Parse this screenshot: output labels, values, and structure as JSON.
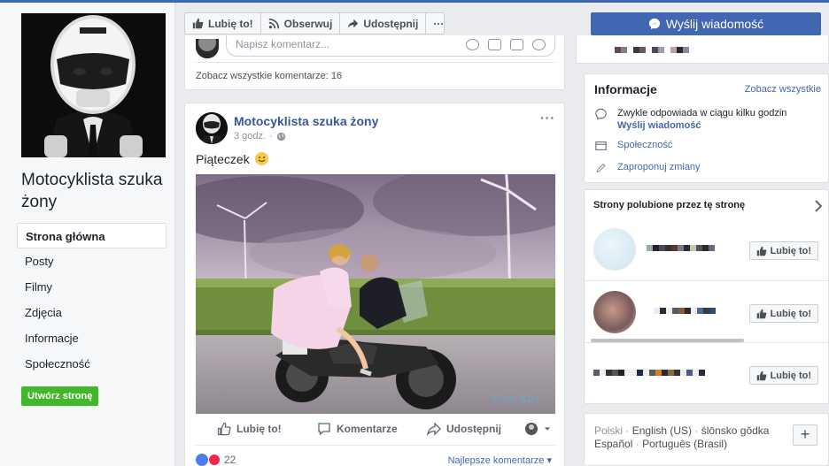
{
  "page": {
    "name": "Motocyklista szuka żony"
  },
  "nav": {
    "items": [
      {
        "label": "Strona główna",
        "active": true
      },
      {
        "label": "Posty"
      },
      {
        "label": "Filmy"
      },
      {
        "label": "Zdjęcia"
      },
      {
        "label": "Informacje"
      },
      {
        "label": "Społeczność"
      }
    ],
    "create_page": "Utwórz stronę"
  },
  "action_bar": {
    "like": "Lubię to!",
    "follow": "Obserwuj",
    "share": "Udostępnij",
    "more": "···"
  },
  "send_message": "Wyślij wiadomość",
  "previous_post": {
    "comment_placeholder": "Napisz komentarz...",
    "see_all_comments": "Zobacz wszystkie komentarze: 16"
  },
  "post": {
    "author": "Motocyklista szuka żony",
    "time": "3 godz.",
    "separator": "·",
    "text": "Piąteczek",
    "menu": "···",
    "photo_signature": "Foto Kus",
    "actions": {
      "like": "Lubię to!",
      "comment": "Komentarze",
      "share": "Udostępnij"
    },
    "reaction_count": "22",
    "comment_sort": "Najlepsze komentarze"
  },
  "info": {
    "title": "Informacje",
    "see_all": "Zobacz wszystkie",
    "response": "Zwykle odpowiada w ciągu kilku godzin",
    "send_message": "Wyślij wiadomość",
    "category": "Społeczność",
    "suggest_edits": "Zaproponuj zmiany"
  },
  "liked_pages": {
    "title": "Strony polubione przez tę stronę",
    "like_label": "Lubię to!"
  },
  "languages": {
    "items": [
      "Polski",
      "English (US)",
      "ślōnsko gŏdka",
      "Español",
      "Português (Brasil)"
    ],
    "separator": "·",
    "plus": "+"
  },
  "colors": {
    "brand_blue": "#4267b2",
    "link_blue": "#365899",
    "green": "#42b72a",
    "background": "#e9ebee"
  }
}
